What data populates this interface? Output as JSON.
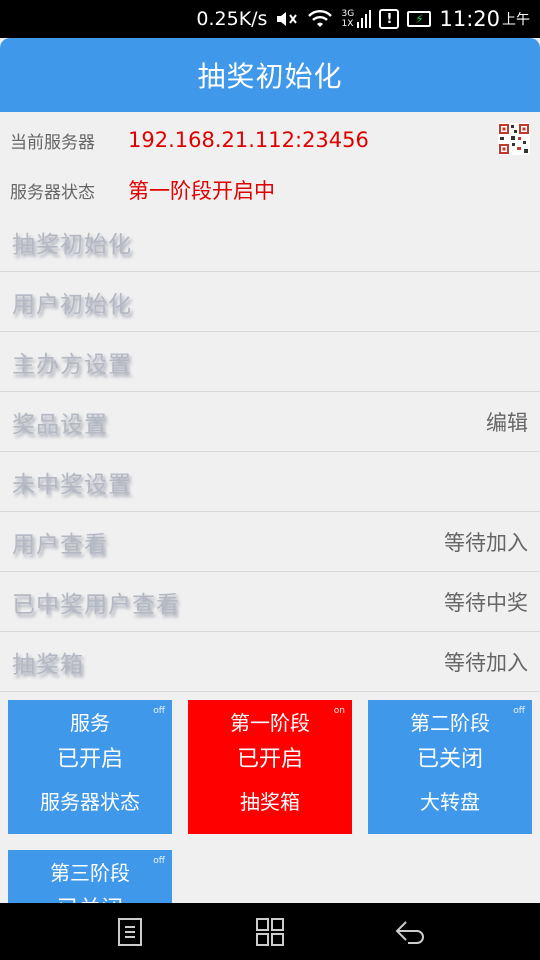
{
  "status_bar": {
    "network_speed": "0.25K/s",
    "signal_label_top": "3G",
    "signal_label_bottom": "1X",
    "notification": "!",
    "time": "11:20",
    "ampm": "上午"
  },
  "header": {
    "title": "抽奖初始化"
  },
  "info": {
    "server_label": "当前服务器",
    "server_value": "192.168.21.112:23456",
    "status_label": "服务器状态",
    "status_value": "第一阶段开启中"
  },
  "menu": {
    "items": [
      {
        "label": "抽奖初始化",
        "status": ""
      },
      {
        "label": "用户初始化",
        "status": ""
      },
      {
        "label": "主办方设置",
        "status": ""
      },
      {
        "label": "奖品设置",
        "status": "编辑"
      },
      {
        "label": "未中奖设置",
        "status": ""
      },
      {
        "label": "用户查看",
        "status": "等待加入"
      },
      {
        "label": "已中奖用户查看",
        "status": "等待中奖"
      },
      {
        "label": "抽奖箱",
        "status": "等待加入"
      }
    ]
  },
  "tiles": [
    {
      "title": "服务",
      "state": "已开启",
      "action": "服务器状态",
      "toggle": "off",
      "color": "#3f98ea"
    },
    {
      "title": "第一阶段",
      "state": "已开启",
      "action": "抽奖箱",
      "toggle": "on",
      "color": "#ff0000"
    },
    {
      "title": "第二阶段",
      "state": "已关闭",
      "action": "大转盘",
      "toggle": "off",
      "color": "#3f98ea"
    },
    {
      "title": "第三阶段",
      "state": "已关闭",
      "action": "",
      "toggle": "off",
      "color": "#3f98ea"
    }
  ],
  "colors": {
    "primary": "#3f98ea",
    "active_tile": "#ff0000",
    "value_red": "#e00000"
  }
}
